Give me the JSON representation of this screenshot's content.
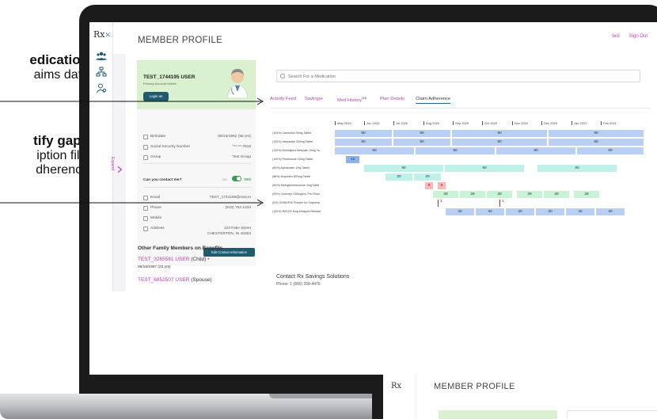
{
  "callouts": [
    {
      "bold": "edication",
      "normal": "aims data"
    },
    {
      "bold": "tify gaps",
      "normal": "iption fills",
      "normal2": "dherence"
    }
  ],
  "app": {
    "logo": "Rx",
    "page_title": "MEMBER PROFILE",
    "top_links": {
      "user": "test",
      "sign_out": "Sign Out"
    },
    "expand_label": "Expand"
  },
  "profile": {
    "name": "TEST_1744195 USER",
    "subtitle": "Primary Account Holder",
    "login_button": "Login as",
    "fields": [
      {
        "icon": "cake-icon",
        "label": "Birthdate",
        "value": "08/16/1962 (58 yrs)"
      },
      {
        "icon": "id-card-icon",
        "label": "Social Security Number",
        "value": "***-**-7618"
      },
      {
        "icon": "group-icon",
        "label": "Group",
        "value": "Test Group"
      }
    ],
    "contact_question": "Can you contact me?",
    "toggle_no": "NO",
    "toggle_yes": "YES",
    "contact_fields": [
      {
        "icon": "mail-icon",
        "label": "Email",
        "value": "TEST_1744195@rxss.in"
      },
      {
        "icon": "phone-icon",
        "label": "Phone",
        "value": "(913) 762 1234"
      },
      {
        "icon": "mobile-icon",
        "label": "Mobile",
        "value": ""
      },
      {
        "icon": "home-icon",
        "label": "Address",
        "value": "123 Fake Street",
        "value2": "CHESTERTON, IN 46304"
      }
    ],
    "edit_button": "Edit Contact Information"
  },
  "family": {
    "title": "Other Family Members on Benefits",
    "members": [
      {
        "name": "TEST_3265581 USER",
        "relation": "(Child)",
        "date": "06/16/1997 (23 yrs)"
      },
      {
        "name": "TEST_6852507 USER",
        "relation": "(Spouse)"
      }
    ]
  },
  "main": {
    "search_placeholder": "Search For a Medication",
    "tabs": [
      {
        "label": "Activity Feed"
      },
      {
        "label": "Savings",
        "dot": "•"
      },
      {
        "label": "Med History",
        "sup": "216"
      },
      {
        "label": "Plan Details"
      },
      {
        "label": "Claim Adherence",
        "active": true
      }
    ],
    "months": [
      "May 2020",
      "Jun 2020",
      "Jul 2020",
      "Aug 2020",
      "Sep 2020",
      "Oct 2020",
      "Nov 2020",
      "Dec 2020",
      "Jan 2021",
      "Feb 2021"
    ],
    "drugs": [
      "(100%) Carvedilol 25mg Tablet",
      "(100%) Irbesartan 300mg Tablet",
      "(100%) Amlodipine Besylate 10mg Ta",
      "(100%) Prednisone 10mg Tablet",
      "(84%) Alprazolam 1mg Tablet",
      "(88%) Ibuprofen 800mg Tablet",
      "(60%) Methylprednisolone 4mg Table",
      "(93%) Cosentyx 150mg/mL Pre-Filled",
      "(0%) SHINGRIX Powder for Suspensi",
      "(100%) RAYOS 5mg Delayed Release"
    ],
    "bar_labels": {
      "r0": [
        "90",
        "90",
        "90",
        "90"
      ],
      "r1": [
        "90",
        "90",
        "90",
        "90"
      ],
      "r2": [
        "90",
        "90",
        "90",
        "90"
      ],
      "r3": [
        "12"
      ],
      "r4": [
        "90",
        "90",
        "90"
      ],
      "r5": [
        "30",
        "30"
      ],
      "r6": [
        "6",
        "6"
      ],
      "r7": [
        "28",
        "28",
        "28",
        "28",
        "28",
        "28"
      ],
      "r8": [
        "1",
        "1"
      ],
      "r9": [
        "30",
        "30",
        "30",
        "30",
        "30",
        "30"
      ]
    },
    "contact_title": "Contact Rx Savings Solutions",
    "contact_phone": "Phone: 1 (800) 268-4476"
  },
  "preview": {
    "logo": "Rx",
    "page_title": "MEMBER PROFILE"
  }
}
